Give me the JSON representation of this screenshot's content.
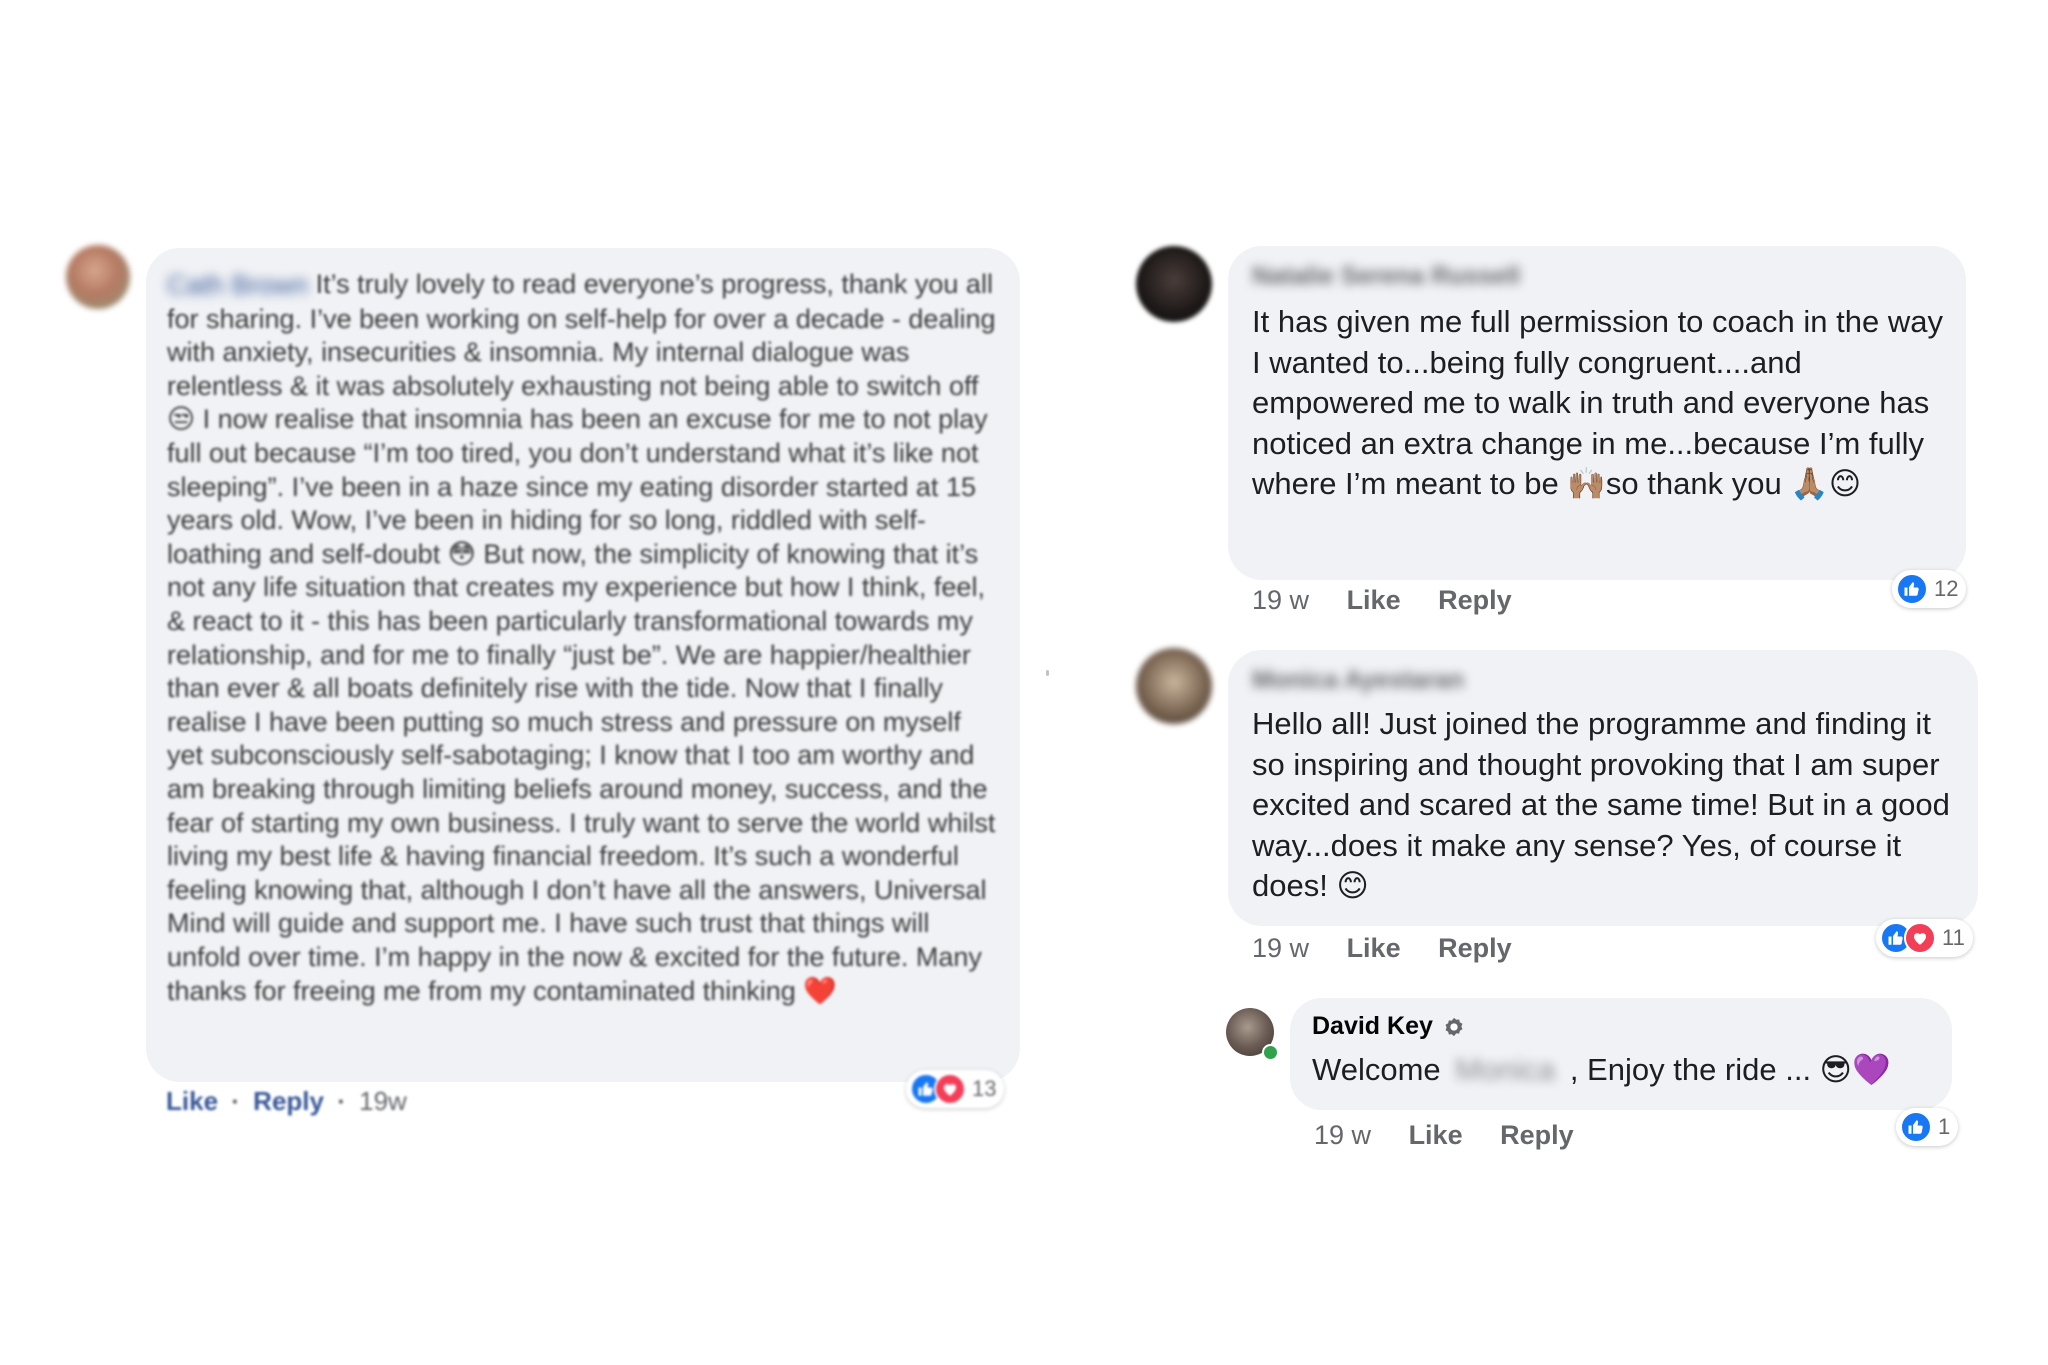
{
  "comment1": {
    "author": "Cath Brown",
    "text": "It’s truly lovely to read everyone’s progress, thank you all for sharing. I’ve been working on self-help for over a decade - dealing with anxiety, insecurities & insomnia. My internal dialogue was relentless & it was absolutely exhausting not being able to switch off 😒 I now realise that insomnia has been an excuse for me to not play full out because “I’m too tired, you don’t understand what it’s like not sleeping”. I’ve been in a haze since my eating disorder started at 15 years old. Wow, I’ve been in hiding for so long, riddled with self-loathing and self-doubt 😳 But now, the simplicity of knowing that it’s not any life situation that creates my experience but how I think, feel, & react to it - this has been particularly transformational towards my relationship, and for me to finally “just be”. We are happier/healthier than ever & all boats definitely rise with the tide. Now that I finally realise I have been putting so much stress and pressure on myself yet subconsciously self-sabotaging; I know that I too am worthy and am breaking through limiting beliefs around money, success, and the fear of starting my own business. I truly want to serve the world whilst living my best life & having financial freedom. It’s such a wonderful feeling knowing that, although I don’t have all the answers, Universal Mind will guide and support me. I have such trust that things will unfold over time. I’m happy in the now & excited for the future. Many thanks for freeing me from my contaminated thinking ❤️",
    "like_label": "Like",
    "sep1": "·",
    "reply_label": "Reply",
    "sep2": "·",
    "time": "19w",
    "reaction_count": "13"
  },
  "comment2": {
    "author": "Natalie Serena Russell",
    "text": "It has given me full permission to coach in the way I wanted to...being fully congruent....and empowered me to walk in truth and everyone has noticed an extra change in me...because I’m fully where I’m meant to be 🙌🏽so thank you 🙏🏽😊",
    "time": "19 w",
    "like_label": "Like",
    "reply_label": "Reply",
    "reaction_count": "12"
  },
  "comment3": {
    "author": "Monica Ayestaran",
    "text": "Hello all! Just joined the programme and finding it so inspiring and thought provoking  that I am super excited and scared at the same time! But in a good way...does it make any sense? Yes, of course it does! 😊",
    "time": "19 w",
    "like_label": "Like",
    "reply_label": "Reply",
    "reaction_count": "11"
  },
  "reply1": {
    "author": "David Key",
    "text_before": "Welcome",
    "mention": "Monica",
    "text_after": ", Enjoy the ride ... 😎💜",
    "time": "19 w",
    "like_label": "Like",
    "reply_label": "Reply",
    "reaction_count": "1"
  },
  "colors": {
    "like": "#1877f2",
    "love": "#f33e58",
    "bubble": "#f0f2f5",
    "meta": "#65676b",
    "link": "#385898"
  }
}
